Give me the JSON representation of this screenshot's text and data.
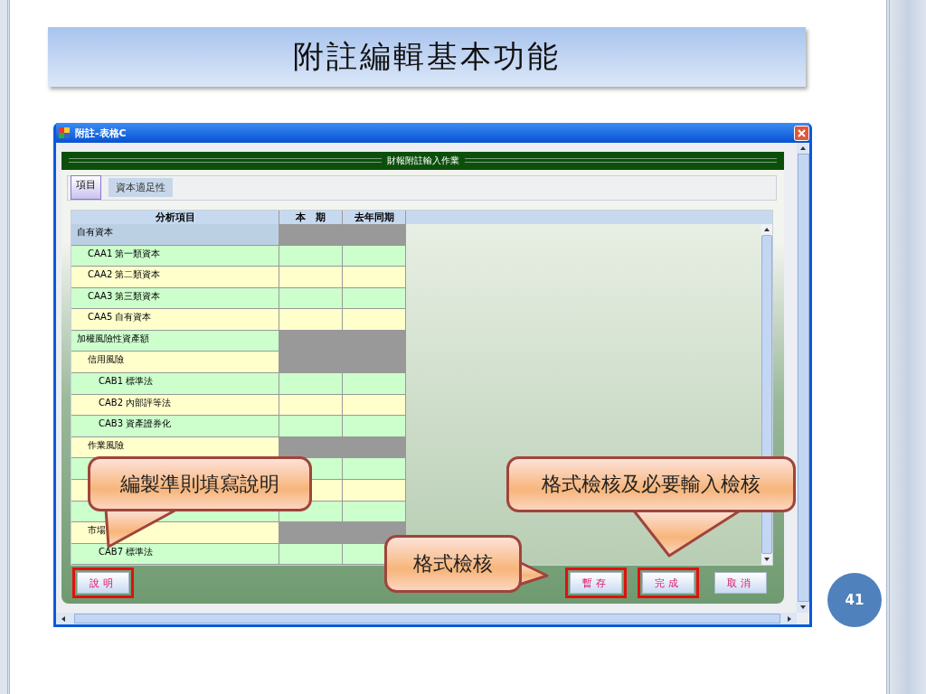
{
  "slide": {
    "title": "附註編輯基本功能",
    "page_number": "41"
  },
  "window": {
    "title": "附註-表格C",
    "header": "財報附註輸入作業",
    "tabs": [
      {
        "label": "項目",
        "selected": true
      },
      {
        "label": "資本適足性",
        "selected": false
      }
    ],
    "table": {
      "columns": [
        "分析項目",
        "本　期",
        "去年同期"
      ],
      "rows": [
        {
          "label": "自有資本",
          "color": "#bcd0e4",
          "shaded": true,
          "children": [
            {
              "label": "CAA1  第一類資本",
              "color": "#ccffcc",
              "shaded": false
            },
            {
              "label": "CAA2  第二類資本",
              "color": "#ffffcc",
              "shaded": false
            },
            {
              "label": "CAA3  第三類資本",
              "color": "#ccffcc",
              "shaded": false
            },
            {
              "label": "CAA5  自有資本",
              "color": "#ffffcc",
              "shaded": false
            }
          ]
        },
        {
          "label": "加權風險性資產額",
          "color": "#ccffcc",
          "shaded": true,
          "children": [
            {
              "label": "信用風險",
              "color": "#ffffcc",
              "shaded": true,
              "children": [
                {
                  "label": "CAB1  標準法",
                  "color": "#ccffcc",
                  "shaded": false
                },
                {
                  "label": "CAB2  內部評等法",
                  "color": "#ffffcc",
                  "shaded": false
                },
                {
                  "label": "CAB3  資產證券化",
                  "color": "#ccffcc",
                  "shaded": false
                }
              ]
            },
            {
              "label": "作業風險",
              "color": "#ffffcc",
              "shaded": true,
              "children": [
                {
                  "color": "#ccffcc",
                  "shaded": false
                },
                {
                  "color": "#ffffcc",
                  "shaded": false
                },
                {
                  "color": "#ccffcc",
                  "shaded": false
                }
              ]
            },
            {
              "label": "市場",
              "color": "#ffffcc",
              "shaded": true,
              "children": [
                {
                  "label": "CAB7  標準法",
                  "color": "#ccffcc",
                  "shaded": false
                }
              ]
            }
          ]
        }
      ]
    },
    "buttons": [
      {
        "label": "說明",
        "highlighted": true
      },
      {
        "label": "暫存",
        "highlighted": true
      },
      {
        "label": "完成",
        "highlighted": true
      },
      {
        "label": "取消",
        "highlighted": false
      }
    ]
  },
  "callouts": [
    {
      "text": "編製準則填寫說明"
    },
    {
      "text": "格式檢核及必要輸入檢核"
    },
    {
      "text": "格式檢核"
    }
  ]
}
